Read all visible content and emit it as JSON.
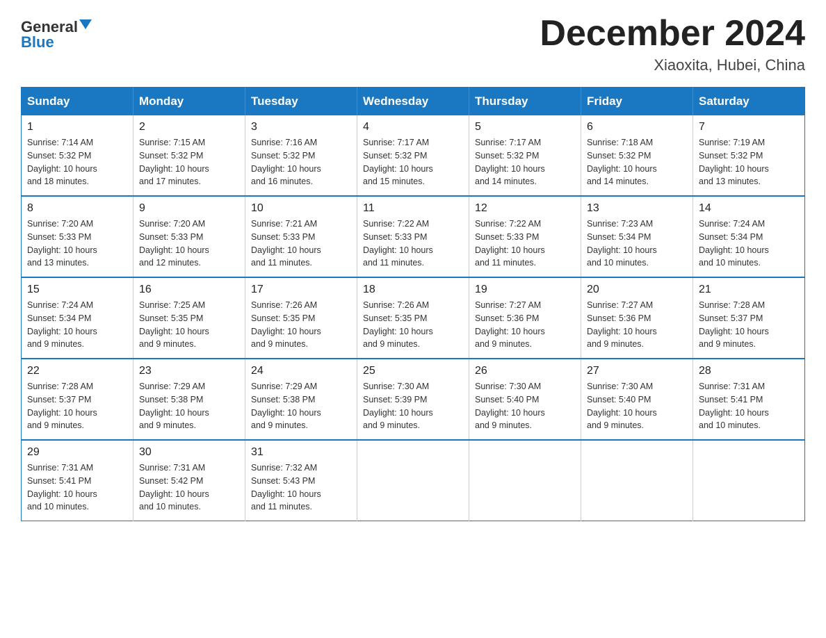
{
  "logo": {
    "general": "General",
    "blue": "Blue"
  },
  "title": "December 2024",
  "location": "Xiaoxita, Hubei, China",
  "days_of_week": [
    "Sunday",
    "Monday",
    "Tuesday",
    "Wednesday",
    "Thursday",
    "Friday",
    "Saturday"
  ],
  "weeks": [
    [
      {
        "day": 1,
        "sunrise": "7:14 AM",
        "sunset": "5:32 PM",
        "daylight": "10 hours and 18 minutes."
      },
      {
        "day": 2,
        "sunrise": "7:15 AM",
        "sunset": "5:32 PM",
        "daylight": "10 hours and 17 minutes."
      },
      {
        "day": 3,
        "sunrise": "7:16 AM",
        "sunset": "5:32 PM",
        "daylight": "10 hours and 16 minutes."
      },
      {
        "day": 4,
        "sunrise": "7:17 AM",
        "sunset": "5:32 PM",
        "daylight": "10 hours and 15 minutes."
      },
      {
        "day": 5,
        "sunrise": "7:17 AM",
        "sunset": "5:32 PM",
        "daylight": "10 hours and 14 minutes."
      },
      {
        "day": 6,
        "sunrise": "7:18 AM",
        "sunset": "5:32 PM",
        "daylight": "10 hours and 14 minutes."
      },
      {
        "day": 7,
        "sunrise": "7:19 AM",
        "sunset": "5:32 PM",
        "daylight": "10 hours and 13 minutes."
      }
    ],
    [
      {
        "day": 8,
        "sunrise": "7:20 AM",
        "sunset": "5:33 PM",
        "daylight": "10 hours and 13 minutes."
      },
      {
        "day": 9,
        "sunrise": "7:20 AM",
        "sunset": "5:33 PM",
        "daylight": "10 hours and 12 minutes."
      },
      {
        "day": 10,
        "sunrise": "7:21 AM",
        "sunset": "5:33 PM",
        "daylight": "10 hours and 11 minutes."
      },
      {
        "day": 11,
        "sunrise": "7:22 AM",
        "sunset": "5:33 PM",
        "daylight": "10 hours and 11 minutes."
      },
      {
        "day": 12,
        "sunrise": "7:22 AM",
        "sunset": "5:33 PM",
        "daylight": "10 hours and 11 minutes."
      },
      {
        "day": 13,
        "sunrise": "7:23 AM",
        "sunset": "5:34 PM",
        "daylight": "10 hours and 10 minutes."
      },
      {
        "day": 14,
        "sunrise": "7:24 AM",
        "sunset": "5:34 PM",
        "daylight": "10 hours and 10 minutes."
      }
    ],
    [
      {
        "day": 15,
        "sunrise": "7:24 AM",
        "sunset": "5:34 PM",
        "daylight": "10 hours and 9 minutes."
      },
      {
        "day": 16,
        "sunrise": "7:25 AM",
        "sunset": "5:35 PM",
        "daylight": "10 hours and 9 minutes."
      },
      {
        "day": 17,
        "sunrise": "7:26 AM",
        "sunset": "5:35 PM",
        "daylight": "10 hours and 9 minutes."
      },
      {
        "day": 18,
        "sunrise": "7:26 AM",
        "sunset": "5:35 PM",
        "daylight": "10 hours and 9 minutes."
      },
      {
        "day": 19,
        "sunrise": "7:27 AM",
        "sunset": "5:36 PM",
        "daylight": "10 hours and 9 minutes."
      },
      {
        "day": 20,
        "sunrise": "7:27 AM",
        "sunset": "5:36 PM",
        "daylight": "10 hours and 9 minutes."
      },
      {
        "day": 21,
        "sunrise": "7:28 AM",
        "sunset": "5:37 PM",
        "daylight": "10 hours and 9 minutes."
      }
    ],
    [
      {
        "day": 22,
        "sunrise": "7:28 AM",
        "sunset": "5:37 PM",
        "daylight": "10 hours and 9 minutes."
      },
      {
        "day": 23,
        "sunrise": "7:29 AM",
        "sunset": "5:38 PM",
        "daylight": "10 hours and 9 minutes."
      },
      {
        "day": 24,
        "sunrise": "7:29 AM",
        "sunset": "5:38 PM",
        "daylight": "10 hours and 9 minutes."
      },
      {
        "day": 25,
        "sunrise": "7:30 AM",
        "sunset": "5:39 PM",
        "daylight": "10 hours and 9 minutes."
      },
      {
        "day": 26,
        "sunrise": "7:30 AM",
        "sunset": "5:40 PM",
        "daylight": "10 hours and 9 minutes."
      },
      {
        "day": 27,
        "sunrise": "7:30 AM",
        "sunset": "5:40 PM",
        "daylight": "10 hours and 9 minutes."
      },
      {
        "day": 28,
        "sunrise": "7:31 AM",
        "sunset": "5:41 PM",
        "daylight": "10 hours and 10 minutes."
      }
    ],
    [
      {
        "day": 29,
        "sunrise": "7:31 AM",
        "sunset": "5:41 PM",
        "daylight": "10 hours and 10 minutes."
      },
      {
        "day": 30,
        "sunrise": "7:31 AM",
        "sunset": "5:42 PM",
        "daylight": "10 hours and 10 minutes."
      },
      {
        "day": 31,
        "sunrise": "7:32 AM",
        "sunset": "5:43 PM",
        "daylight": "10 hours and 11 minutes."
      },
      null,
      null,
      null,
      null
    ]
  ],
  "labels": {
    "sunrise": "Sunrise:",
    "sunset": "Sunset:",
    "daylight": "Daylight:"
  }
}
